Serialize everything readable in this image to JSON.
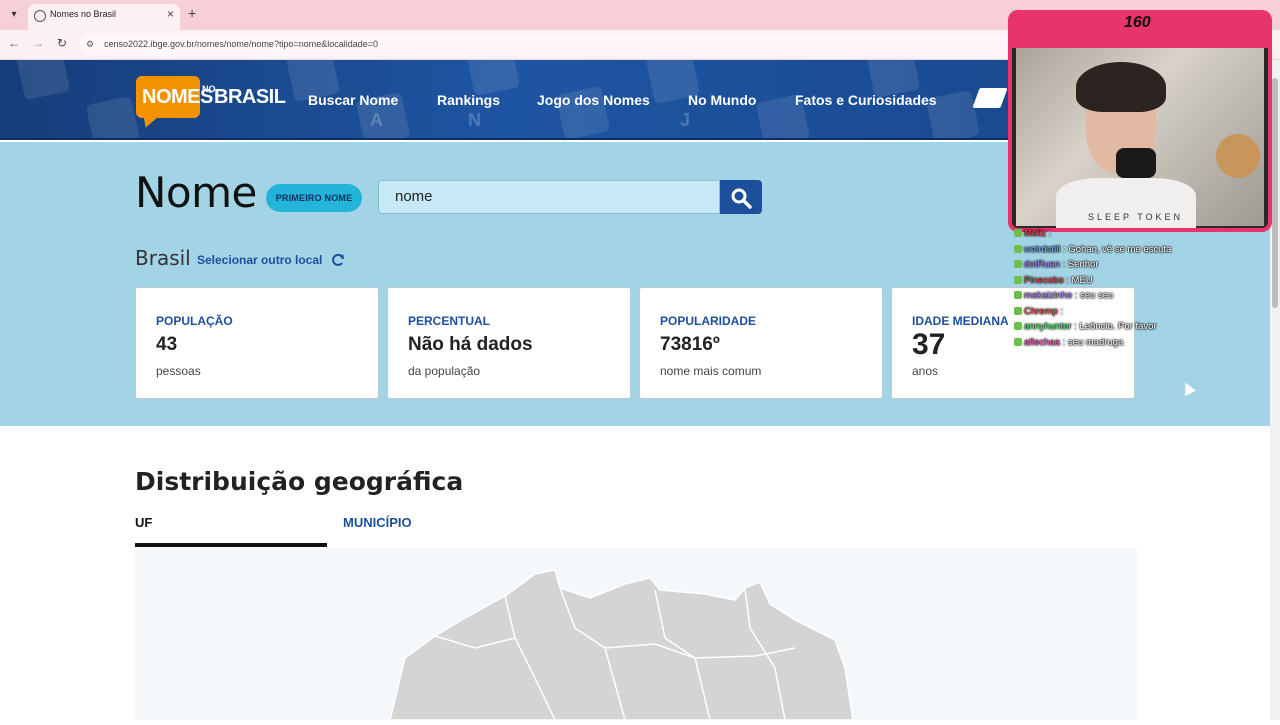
{
  "browser": {
    "tab_title": "Nomes no Brasil",
    "url": "censo2022.ibge.gov.br/nomes/nome/nome?tipo=nome&localidade=0"
  },
  "header": {
    "logo_nomes": "NOMES",
    "logo_no": "NO",
    "logo_brasil": "BRASIL",
    "nav": [
      "Buscar Nome",
      "Rankings",
      "Jogo dos Nomes",
      "No Mundo",
      "Fatos e Curiosidades"
    ]
  },
  "hero": {
    "title": "Nome",
    "type_pill": "PRIMEIRO NOME",
    "search_value": "nome",
    "location": "Brasil",
    "select_location": "Selecionar outro local"
  },
  "cards": [
    {
      "label": "POPULAÇÃO",
      "value": "43",
      "sub": "pessoas"
    },
    {
      "label": "PERCENTUAL",
      "value": "Não há dados",
      "sub": "da população"
    },
    {
      "label": "POPULARIDADE",
      "value": "73816º",
      "sub": "nome mais comum"
    },
    {
      "label": "IDADE MEDIANA",
      "value": "37",
      "sub": "anos"
    }
  ],
  "distribution": {
    "title": "Distribuição geográfica",
    "tabs": [
      "UF",
      "MUNICÍPIO"
    ]
  },
  "overlay": {
    "count": "160",
    "shirt": "SLEEP TOKEN",
    "chat": [
      {
        "user": "Meliz",
        "msg": "",
        "color": "#ff4d4d"
      },
      {
        "user": "weirdstill",
        "msg": "Gohan, vê se me escuta",
        "color": "#7fb3ff"
      },
      {
        "user": "dotRuan",
        "msg": "Senhor",
        "color": "#b48cff"
      },
      {
        "user": "Pinecobo",
        "msg": "MEU",
        "color": "#ff4d4d"
      },
      {
        "user": "makaizinho",
        "msg": "seu seu",
        "color": "#b48cff"
      },
      {
        "user": "Chremp",
        "msg": "",
        "color": "#ff4d4d"
      },
      {
        "user": "annyhunter",
        "msg": "Leôncio. Por favor",
        "color": "#4dff6a"
      },
      {
        "user": "aflechaa",
        "msg": "seu madruga",
        "color": "#ff66cc"
      }
    ]
  }
}
